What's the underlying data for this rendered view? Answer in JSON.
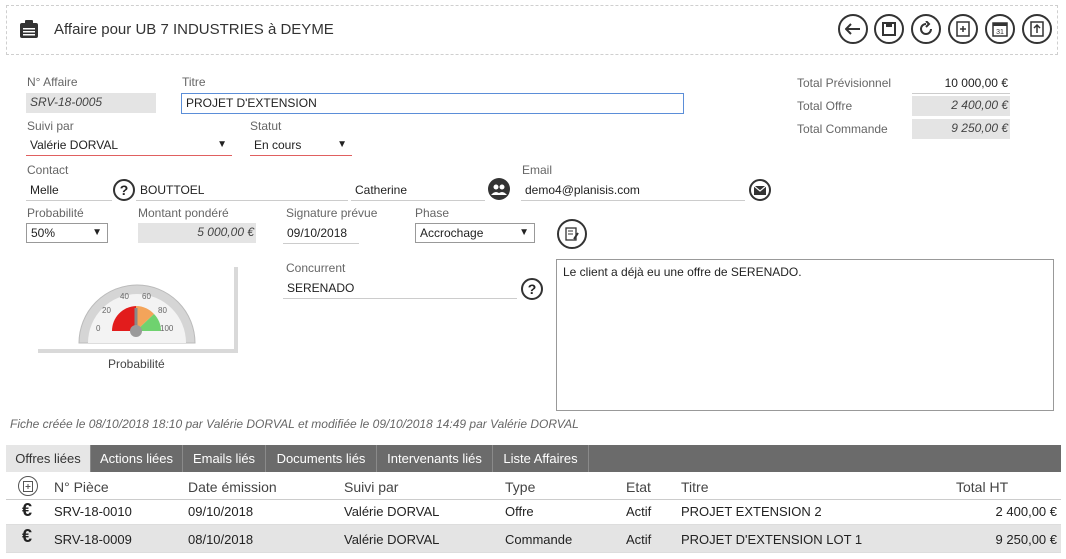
{
  "header": {
    "title": "Affaire pour UB 7 INDUSTRIES à DEYME"
  },
  "form": {
    "numero_label": "N° Affaire",
    "numero_value": "SRV-18-0005",
    "titre_label": "Titre",
    "titre_value": "PROJET D'EXTENSION",
    "suivi_label": "Suivi par",
    "suivi_value": "Valérie DORVAL",
    "statut_label": "Statut",
    "statut_value": "En cours",
    "contact_label": "Contact",
    "civilite": "Melle",
    "nom": "BOUTTOEL",
    "prenom": "Catherine",
    "email_label": "Email",
    "email_value": "demo4@planisis.com",
    "probabilite_label": "Probabilité",
    "probabilite_value": "50%",
    "montant_label": "Montant pondéré",
    "montant_value": "5 000,00 €",
    "signature_label": "Signature prévue",
    "signature_value": "09/10/2018",
    "phase_label": "Phase",
    "phase_value": "Accrochage",
    "concurrent_label": "Concurrent",
    "concurrent_value": "SERENADO",
    "note_value": "Le client a déjà eu une offre de SERENADO."
  },
  "totals": {
    "prev_label": "Total Prévisionnel",
    "prev_value": "10 000,00 €",
    "offre_label": "Total Offre",
    "offre_value": "2 400,00 €",
    "commande_label": "Total Commande",
    "commande_value": "9 250,00 €"
  },
  "gauge": {
    "label": "Probabilité",
    "value": 50,
    "ticks": [
      "0",
      "20",
      "40",
      "60",
      "80",
      "100"
    ]
  },
  "footer_note": "Fiche créée le 08/10/2018 18:10 par Valérie DORVAL et modifiée le 09/10/2018 14:49 par Valérie DORVAL",
  "tabs": [
    "Offres liées",
    "Actions liées",
    "Emails liés",
    "Documents liés",
    "Intervenants liés",
    "Liste Affaires"
  ],
  "table": {
    "headers": [
      "N° Pièce",
      "Date émission",
      "Suivi par",
      "Type",
      "Etat",
      "Titre",
      "Total HT"
    ],
    "rows": [
      {
        "icon": "€",
        "piece": "SRV-18-0010",
        "date": "09/10/2018",
        "suivi": "Valérie DORVAL",
        "type": "Offre",
        "etat": "Actif",
        "titre": "PROJET EXTENSION 2",
        "total": "2 400,00 €"
      },
      {
        "icon": "€",
        "piece": "SRV-18-0009",
        "date": "08/10/2018",
        "suivi": "Valérie DORVAL",
        "type": "Commande",
        "etat": "Actif",
        "titre": "PROJET D'EXTENSION LOT 1",
        "total": "9 250,00 €"
      }
    ]
  }
}
